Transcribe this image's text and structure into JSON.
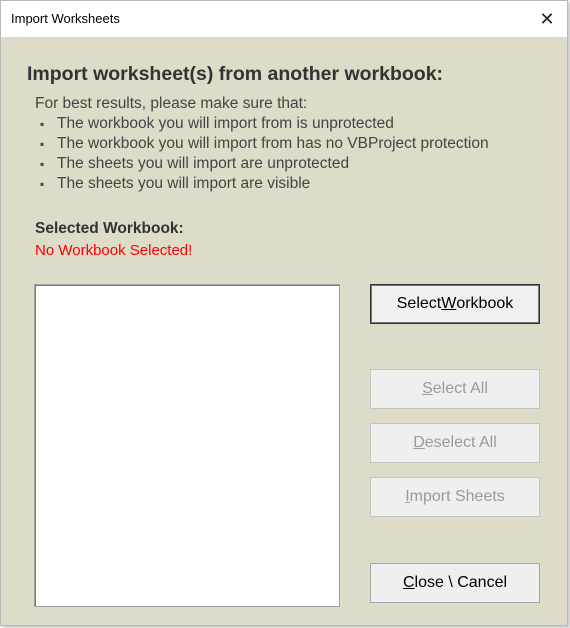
{
  "window": {
    "title": "Import Worksheets",
    "close_glyph": "✕"
  },
  "content": {
    "heading": "Import worksheet(s) from another workbook:",
    "intro": "For best results, please make sure that:",
    "bullet_glyph": "▪",
    "bullets": [
      "The workbook you will import from is unprotected",
      "The workbook you will import from has no VBProject protection",
      "The sheets you will import are unprotected",
      "The sheets you will import are visible"
    ],
    "selected_label": "Selected Workbook:",
    "selected_value": "No Workbook Selected!",
    "selected_value_color": "#ff0000"
  },
  "sheet_list": {
    "items": []
  },
  "buttons": {
    "select_workbook": {
      "pre": "Select ",
      "mnemonic": "W",
      "post": "orkbook",
      "enabled": true
    },
    "select_all": {
      "pre": "",
      "mnemonic": "S",
      "post": "elect All",
      "enabled": false
    },
    "deselect_all": {
      "pre": "",
      "mnemonic": "D",
      "post": "eselect All",
      "enabled": false
    },
    "import_sheets": {
      "pre": "",
      "mnemonic": "I",
      "post": "mport Sheets",
      "enabled": false
    },
    "close_cancel": {
      "pre": "",
      "mnemonic": "C",
      "post": "lose \\ Cancel",
      "enabled": true
    }
  },
  "colors": {
    "dialog_background": "#dedbc9",
    "disabled_text": "#9a9a9a"
  }
}
